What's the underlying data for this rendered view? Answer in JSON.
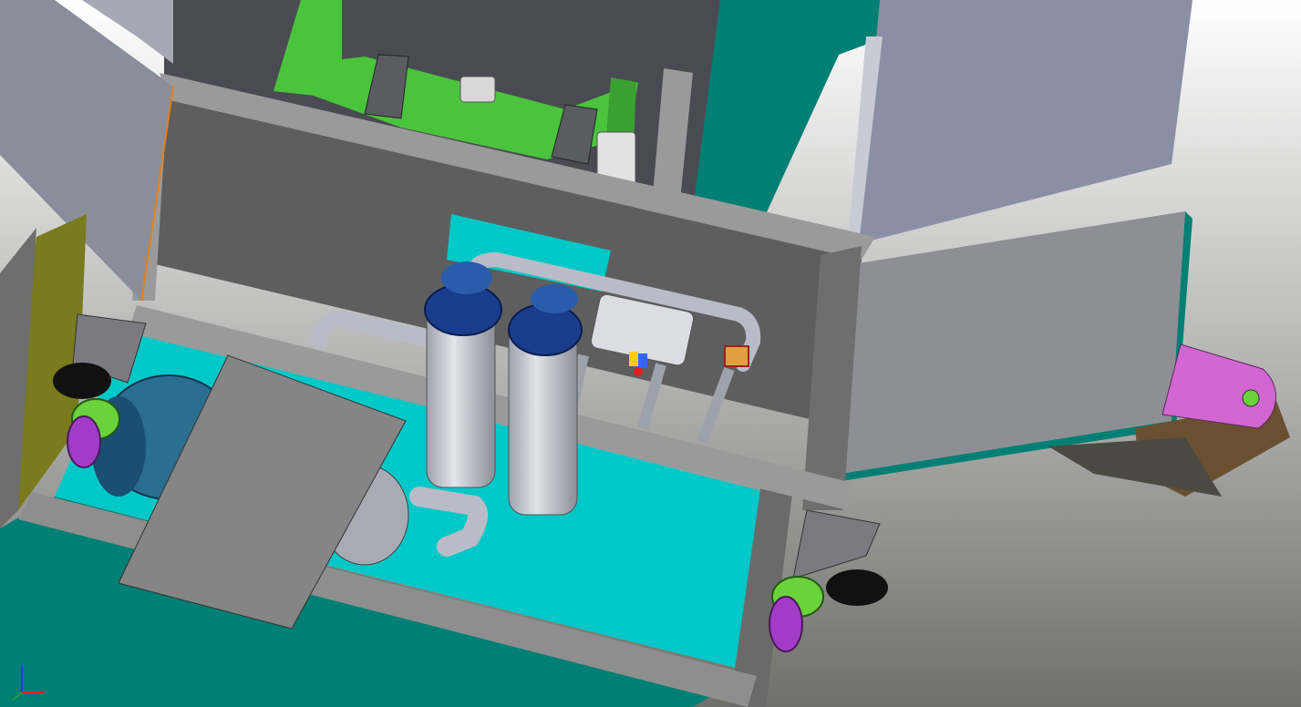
{
  "viewport": {
    "background_top": "#ffffff",
    "background_bottom": "#6f6f6b"
  },
  "colors": {
    "frame_gray": "#5e5e5e",
    "frame_light": "#9a9a9a",
    "panel_gray": "#8a8fa5",
    "teal": "#007f74",
    "cyan": "#00c8c8",
    "green": "#4ac43c",
    "pipe": "#b9bcc8",
    "filter_blue": "#1a3c8c",
    "motor_blue": "#2a6e92",
    "wheel_purple": "#a23cc8",
    "wheel_green": "#6ad23a",
    "chain_pink": "#d266d2",
    "chain_brown": "#6a5030",
    "olive": "#7a7a1e",
    "edge_orange": "#e08020",
    "valve_yellow": "#ffd000",
    "valve_blue": "#3264ff",
    "valve_red": "#e02020"
  },
  "icons": {
    "axis_triad": "axis-triad-icon"
  }
}
